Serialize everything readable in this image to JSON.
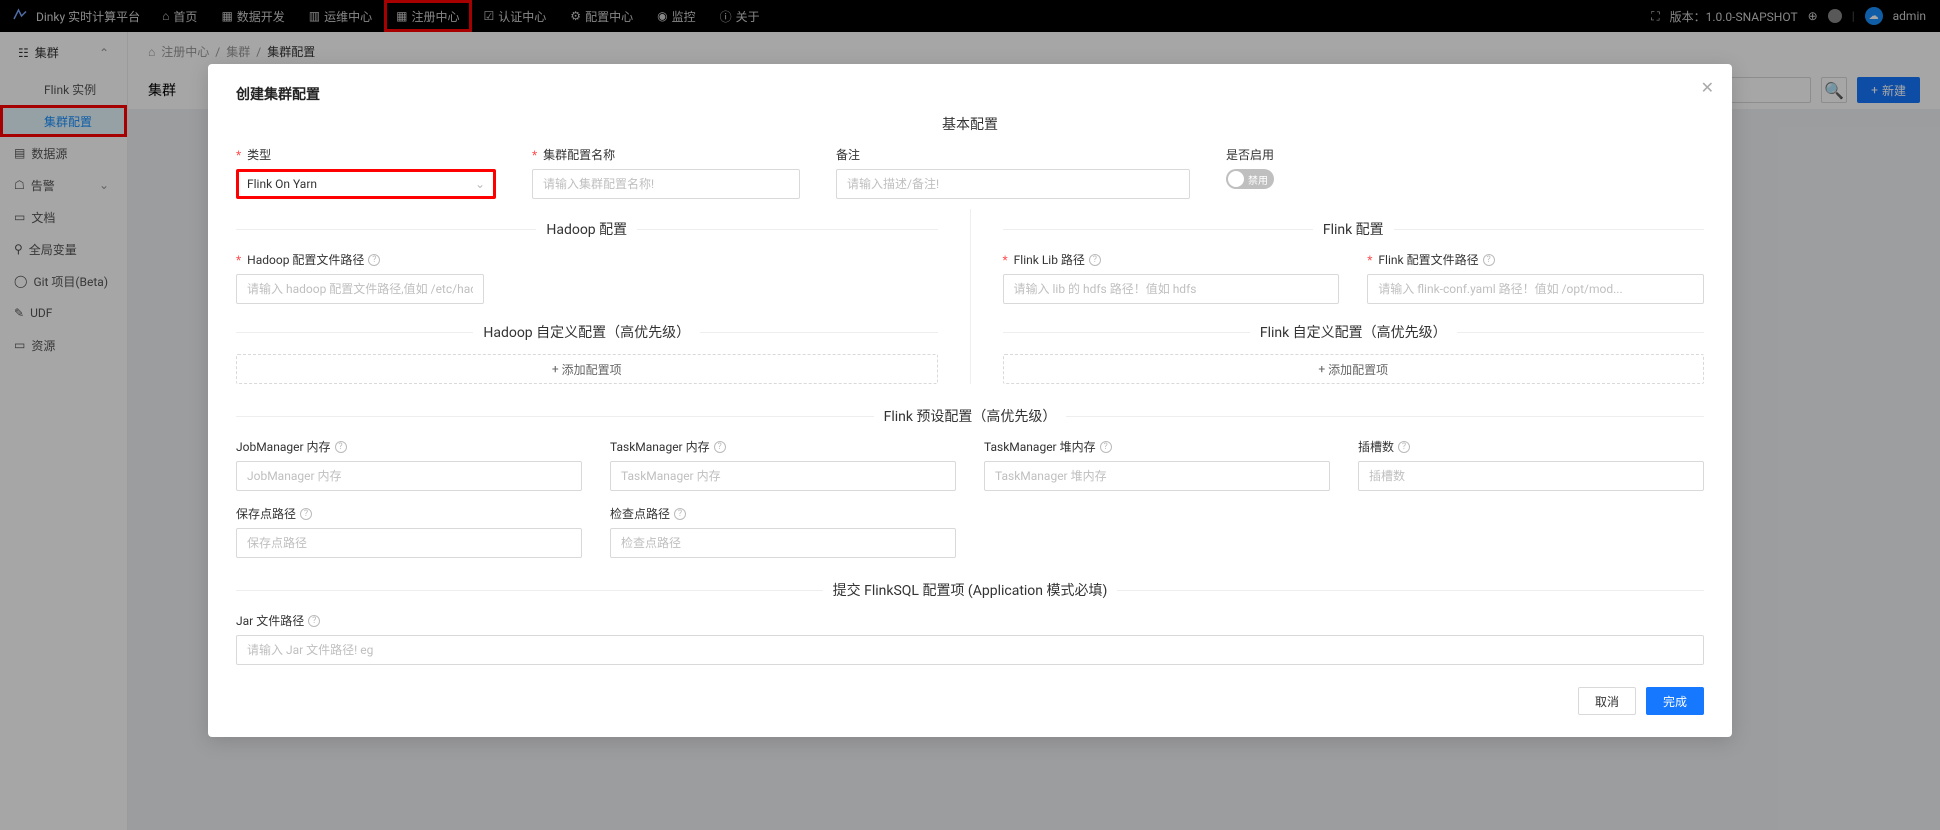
{
  "app": {
    "name": "Dinky 实时计算平台"
  },
  "topnav": {
    "items": [
      {
        "label": "首页",
        "icon": "home-icon"
      },
      {
        "label": "数据开发",
        "icon": "code-icon"
      },
      {
        "label": "运维中心",
        "icon": "ops-icon"
      },
      {
        "label": "注册中心",
        "icon": "grid-icon"
      },
      {
        "label": "认证中心",
        "icon": "shield-icon"
      },
      {
        "label": "配置中心",
        "icon": "gear-icon"
      },
      {
        "label": "监控",
        "icon": "monitor-icon"
      },
      {
        "label": "关于",
        "icon": "info-icon"
      }
    ],
    "version": "版本：1.0.0-SNAPSHOT",
    "user": "admin"
  },
  "sidebar": {
    "header": {
      "icon": "cluster-icon",
      "label": "集群"
    },
    "items": [
      {
        "label": "Flink 实例"
      },
      {
        "label": "集群配置"
      }
    ],
    "bottom_items": [
      {
        "icon": "db-icon",
        "label": "数据源"
      },
      {
        "icon": "alert-icon",
        "label": "告警"
      },
      {
        "icon": "doc-icon",
        "label": "文档"
      },
      {
        "icon": "var-icon",
        "label": "全局变量"
      },
      {
        "icon": "git-icon",
        "label": "Git 项目(Beta)"
      },
      {
        "icon": "udf-icon",
        "label": "UDF"
      },
      {
        "icon": "res-icon",
        "label": "资源"
      }
    ]
  },
  "breadcrumb": [
    "注册中心",
    "集群",
    "集群配置"
  ],
  "page": {
    "title": "集群",
    "new_btn": "新建"
  },
  "modal": {
    "title": "创建集群配置",
    "sections": {
      "basic": "基本配置",
      "hadoop": "Hadoop 配置",
      "flink": "Flink 配置",
      "hadoop_custom": "Hadoop 自定义配置（高优先级）",
      "flink_custom": "Flink 自定义配置（高优先级）",
      "flink_preset": "Flink 预设配置（高优先级）",
      "submit": "提交 FlinkSQL 配置项 (Application 模式必填)"
    },
    "fields": {
      "type": {
        "label": "类型",
        "value": "Flink On Yarn"
      },
      "name": {
        "label": "集群配置名称",
        "placeholder": "请输入集群配置名称!"
      },
      "remark": {
        "label": "备注",
        "placeholder": "请输入描述/备注!"
      },
      "enabled": {
        "label": "是否启用",
        "state": "禁用"
      },
      "hadoop_conf": {
        "label": "Hadoop 配置文件路径",
        "placeholder": "请输入 hadoop 配置文件路径,值如 /etc/had..."
      },
      "flink_lib": {
        "label": "Flink Lib 路径",
        "placeholder": "请输入 lib 的 hdfs 路径！值如 hdfs"
      },
      "flink_conf": {
        "label": "Flink 配置文件路径",
        "placeholder": "请输入 flink-conf.yaml 路径！值如 /opt/mod..."
      },
      "add_config": "添加配置项",
      "jm_mem": {
        "label": "JobManager 内存",
        "placeholder": "JobManager 内存"
      },
      "tm_mem": {
        "label": "TaskManager 内存",
        "placeholder": "TaskManager 内存"
      },
      "tm_heap": {
        "label": "TaskManager 堆内存",
        "placeholder": "TaskManager 堆内存"
      },
      "slots": {
        "label": "插槽数",
        "placeholder": "插槽数"
      },
      "savepoint": {
        "label": "保存点路径",
        "placeholder": "保存点路径"
      },
      "checkpoint": {
        "label": "检查点路径",
        "placeholder": "检查点路径"
      },
      "jar": {
        "label": "Jar 文件路径",
        "placeholder": "请输入 Jar 文件路径! eg"
      }
    },
    "footer": {
      "cancel": "取消",
      "ok": "完成"
    }
  }
}
